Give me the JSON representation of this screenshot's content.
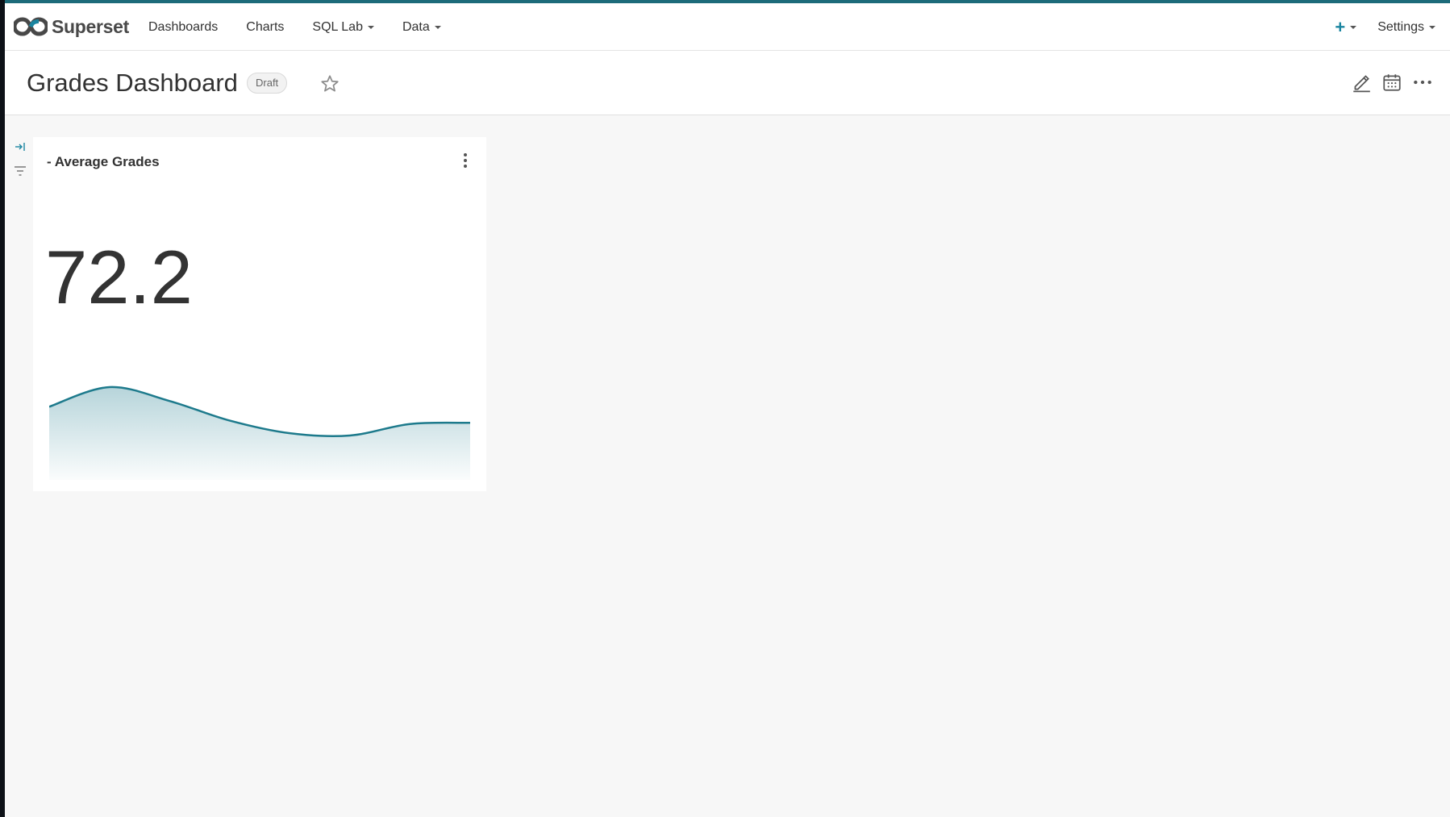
{
  "navbar": {
    "brand": "Superset",
    "items": [
      {
        "label": "Dashboards",
        "has_caret": false
      },
      {
        "label": "Charts",
        "has_caret": false
      },
      {
        "label": "SQL Lab",
        "has_caret": true
      },
      {
        "label": "Data",
        "has_caret": true
      }
    ],
    "settings_label": "Settings",
    "plus_icon": "plus-icon"
  },
  "dashboard": {
    "title": "Grades Dashboard",
    "status_badge": "Draft"
  },
  "chart": {
    "title": "- Average Grades",
    "big_number": "72.2"
  },
  "chart_data": {
    "type": "area",
    "x": [
      0,
      1,
      2,
      3,
      4,
      5,
      6,
      7
    ],
    "values": [
      74.8,
      76.5,
      75.3,
      73.6,
      72.5,
      72.3,
      73.3,
      73.4
    ],
    "title": "",
    "xlabel": "",
    "ylabel": ""
  },
  "colors": {
    "accent": "#1a85a0",
    "trend_line": "#1d7a8c",
    "top_bar": "#1d6b7a"
  }
}
